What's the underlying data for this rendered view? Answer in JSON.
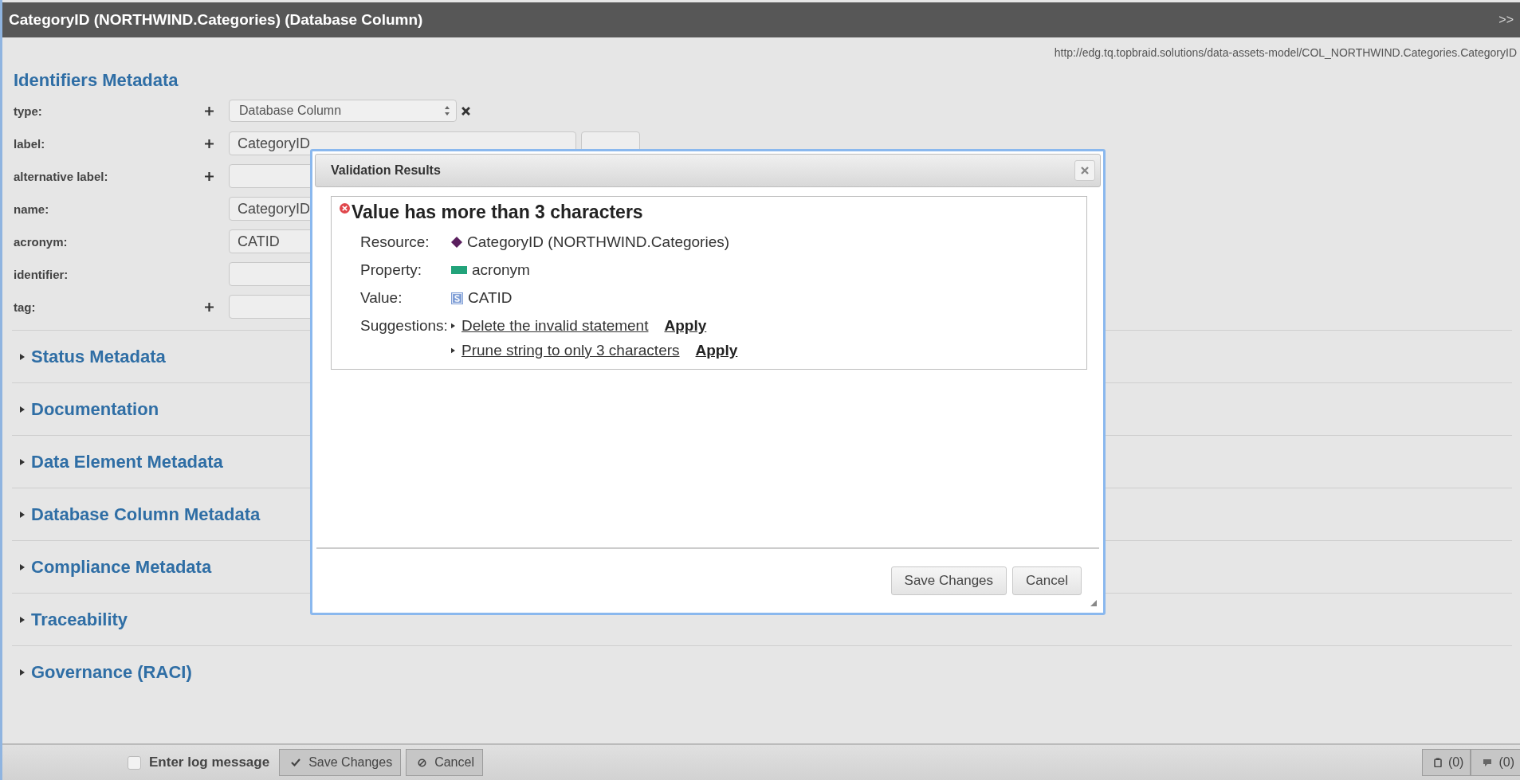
{
  "header": {
    "title": "CategoryID (NORTHWIND.Categories) (Database Column)",
    "collapse": ">>"
  },
  "uri": "http://edg.tq.topbraid.solutions/data-assets-model/COL_NORTHWIND.Categories.CategoryID",
  "identifiers": {
    "title": "Identifiers Metadata",
    "fields": [
      {
        "label": "type:",
        "plus": true,
        "kind": "select",
        "value": "Database Column"
      },
      {
        "label": "label:",
        "plus": true,
        "kind": "text-lang",
        "value": "CategoryID"
      },
      {
        "label": "alternative label:",
        "plus": true,
        "kind": "text"
      },
      {
        "label": "name:",
        "plus": false,
        "kind": "text",
        "value": "CategoryID"
      },
      {
        "label": "acronym:",
        "plus": false,
        "kind": "text",
        "value": "CATID"
      },
      {
        "label": "identifier:",
        "plus": false,
        "kind": "text"
      },
      {
        "label": "tag:",
        "plus": true,
        "kind": "text"
      }
    ]
  },
  "sections": [
    {
      "title": "Status Metadata",
      "expanded": false
    },
    {
      "title": "Documentation",
      "expanded": false
    },
    {
      "title": "Data Element Metadata",
      "expanded": false
    },
    {
      "title": "Database Column Metadata",
      "expanded": false
    },
    {
      "title": "Compliance Metadata",
      "expanded": false
    },
    {
      "title": "Traceability",
      "expanded": false
    },
    {
      "title": "Governance (RACI)",
      "expanded": false
    }
  ],
  "dialog": {
    "title": "Validation Results",
    "message": "Value has more than 3 characters",
    "details": [
      {
        "kind": "resource",
        "label": "Resource:",
        "value": "CategoryID (NORTHWIND.Categories)"
      },
      {
        "kind": "property",
        "label": "Property:",
        "value": "acronym"
      },
      {
        "kind": "value",
        "label": "Value:",
        "value": "CATID"
      }
    ],
    "suggestions_label": "Suggestions:",
    "suggestions": [
      {
        "text": "Delete the invalid statement",
        "action": "Apply"
      },
      {
        "text": "Prune string to only 3 characters",
        "action": "Apply"
      }
    ],
    "buttons": [
      "Save Changes",
      "Cancel"
    ]
  },
  "footer": {
    "log": {
      "label": "Enter log message",
      "checked": false
    },
    "save": "Save Changes",
    "cancel": "Cancel",
    "clipboard_count": "(0)",
    "comments_count": "(0)"
  }
}
